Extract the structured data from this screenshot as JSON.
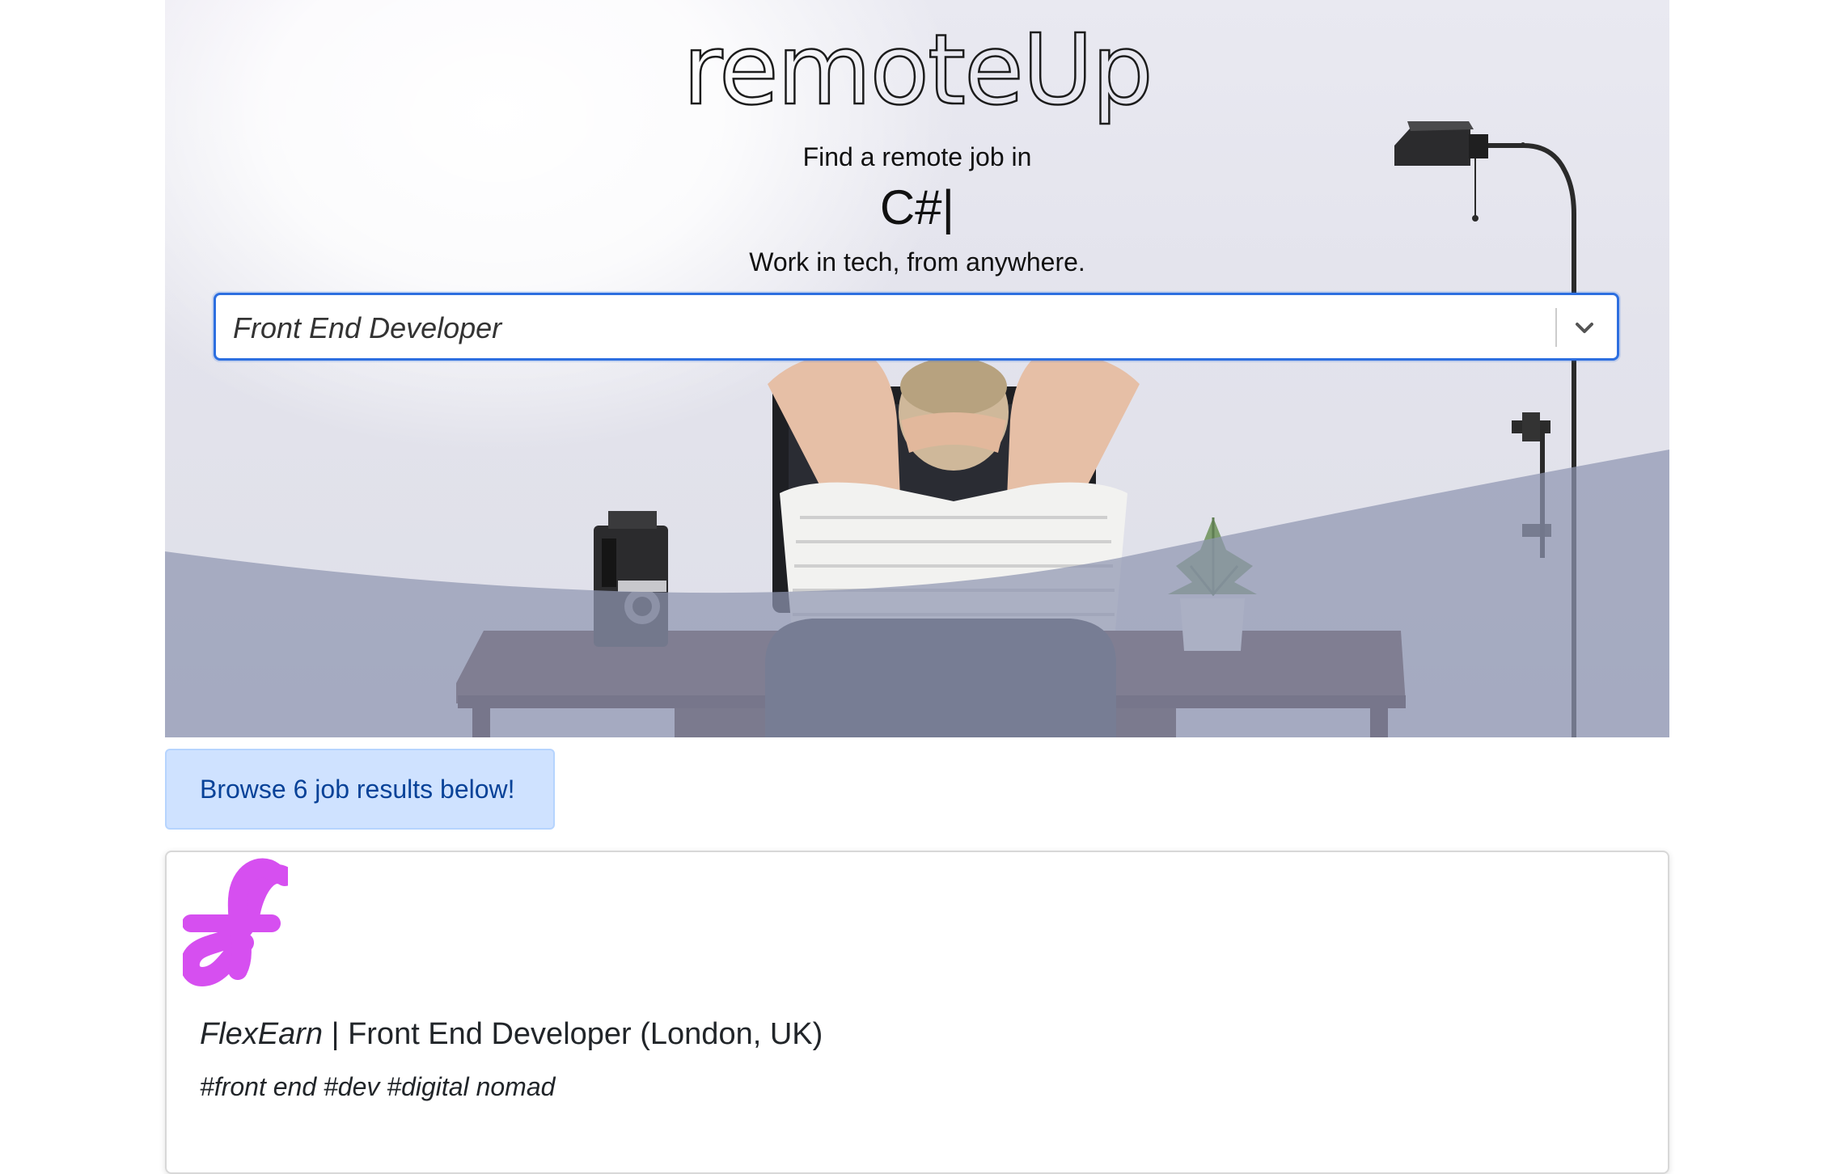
{
  "hero": {
    "brand": "remoteUp",
    "find_text": "Find a remote job in",
    "typed_language": "C#",
    "typing_cursor": "|",
    "tagline": "Work in tech, from anywhere.",
    "role_select": {
      "selected_value": "Front End Developer",
      "chevron_icon": "chevron-down-icon"
    }
  },
  "alert": {
    "text": "Browse 6 job results below!"
  },
  "jobs": [
    {
      "company": "FlexEarn",
      "separator": " | ",
      "title": "Front End Developer (London, UK)",
      "tags": "#front end #dev #digital nomad",
      "logo_icon": "flexearn-logo",
      "logo_color": "#d64ff0"
    }
  ],
  "colors": {
    "focus_border": "#2d6fe0",
    "alert_bg": "#cfe2ff",
    "alert_text": "#084298",
    "wave": "#a3a8bf"
  }
}
